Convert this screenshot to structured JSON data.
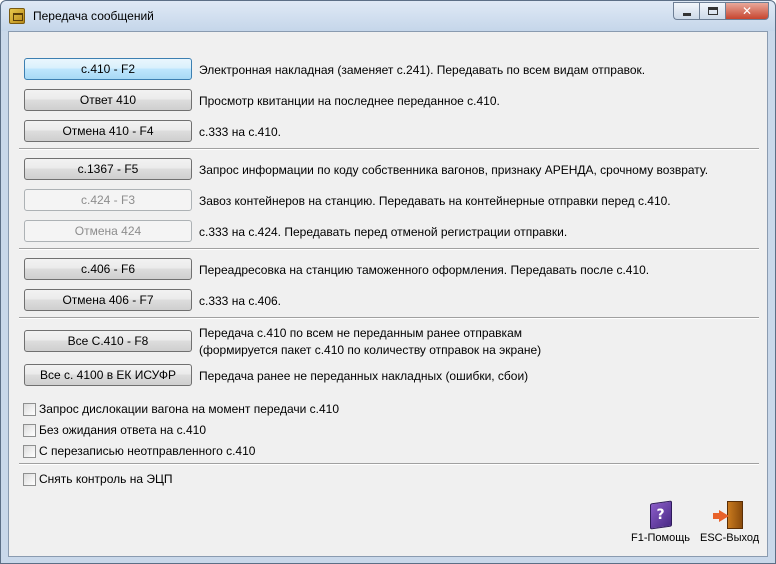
{
  "window": {
    "title": "Передача сообщений"
  },
  "buttons": [
    {
      "label": "с.410 - F2",
      "desc": "Электронная накладная (заменяет с.241). Передавать по всем видам отправок.",
      "state": "focused"
    },
    {
      "label": "Ответ 410",
      "desc": "Просмотр квитанции на последнее переданное с.410.",
      "state": "normal"
    },
    {
      "label": "Отмена 410 - F4",
      "desc": "с.333 на с.410.",
      "state": "normal"
    },
    {
      "label": "с.1367 - F5",
      "desc": "Запрос информации по коду собственника вагонов, признаку АРЕНДА, срочному  возврату.",
      "state": "normal"
    },
    {
      "label": "с.424 - F3",
      "desc": "Завоз контейнеров на станцию. Передавать на контейнерные отправки перед с.410.",
      "state": "disabled"
    },
    {
      "label": "Отмена 424",
      "desc": "с.333 на с.424. Передавать перед отменой регистрации отправки.",
      "state": "disabled"
    },
    {
      "label": "с.406 - F6",
      "desc": "Переадресовка на станцию таможенного оформления. Передавать после с.410.",
      "state": "normal"
    },
    {
      "label": "Отмена 406 - F7",
      "desc": "с.333 на с.406.",
      "state": "normal"
    },
    {
      "label": "Все С.410 - F8",
      "desc": "Передача с.410 по всем не переданным ранее отправкам",
      "desc2": " (формируется пакет с.410 по количеству отправок на экране)",
      "state": "normal"
    },
    {
      "label": "Все с. 4100 в ЕК ИСУФР",
      "desc": "Передача ранее не переданных накладных (ошибки, сбои)",
      "state": "normal"
    }
  ],
  "checkboxes": [
    {
      "label": "Запрос дислокации вагона на момент передачи с.410",
      "checked": false
    },
    {
      "label": "Без ожидания ответа на с.410",
      "checked": false
    },
    {
      "label": "С перезаписью неотправленного с.410",
      "checked": false
    },
    {
      "label": "Снять контроль на ЭЦП",
      "checked": false
    }
  ],
  "footer": {
    "help_label": "F1-Помощь",
    "exit_label": "ESC-Выход"
  }
}
